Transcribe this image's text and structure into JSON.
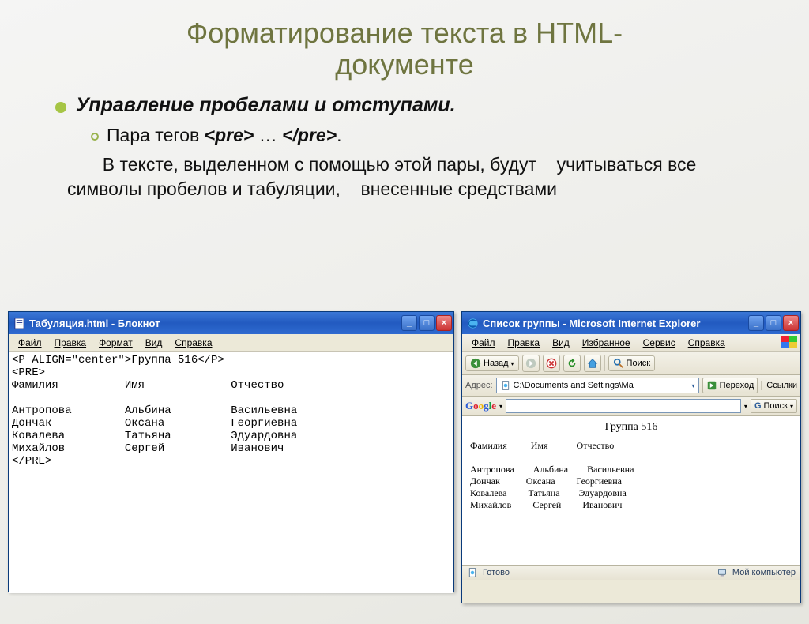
{
  "slide": {
    "title_line1": "Форматирование текста в HTML-",
    "title_line2": "документе",
    "bullet1": "Управление пробелами и отступами.",
    "bullet2_prefix": "Пара тегов ",
    "bullet2_pre_open": "<pre>",
    "bullet2_dots": " … ",
    "bullet2_pre_close": "</pre>",
    "bullet2_suffix": ".",
    "body": "       В тексте, выделенном с помощью этой пары, будут    учитываться все символы пробелов и табуляции,    внесенные средствами"
  },
  "notepad": {
    "title": "Табуляция.html - Блокнот",
    "menu": [
      "Файл",
      "Правка",
      "Формат",
      "Вид",
      "Справка"
    ],
    "content": "<P ALIGN=\"center\">Группа 516</P>\n<PRE>\nФамилия          Имя             Отчество\n\nАнтропова        Альбина         Васильевна\nДончак           Оксана          Георгиевна\nКовалева         Татьяна         Эдуардовна\nМихайлов         Сергей          Иванович\n</PRE>"
  },
  "ie": {
    "title": "Список группы - Microsoft Internet Explorer",
    "menu": [
      "Файл",
      "Правка",
      "Вид",
      "Избранное",
      "Сервис",
      "Справка"
    ],
    "back_label": "Назад",
    "search_label": "Поиск",
    "address_label": "Адрес:",
    "address_value": "C:\\Documents and Settings\\Ма",
    "go_label": "Переход",
    "links_label": "Ссылки",
    "google_search_label": "Поиск",
    "heading": "Группа 516",
    "pre": "Фамилия          Имя            Отчество\n\nАнтропова        Альбина        Васильевна\nДончак           Оксана         Георгиевна\nКовалева         Татьяна        Эдуардовна\nМихайлов         Сергей         Иванович",
    "status_ready": "Готово",
    "status_zone": "Мой компьютер"
  },
  "icons": {
    "min": "_",
    "max": "□",
    "close": "×",
    "dropdown": "▾"
  }
}
